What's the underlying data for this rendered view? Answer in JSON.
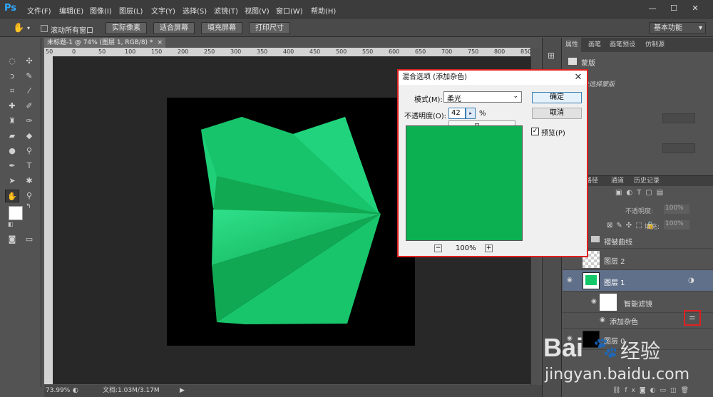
{
  "app": {
    "logo": "Ps"
  },
  "menu": [
    "文件(F)",
    "编辑(E)",
    "图像(I)",
    "图层(L)",
    "文字(Y)",
    "选择(S)",
    "滤镜(T)",
    "视图(V)",
    "窗口(W)",
    "帮助(H)"
  ],
  "window_controls": [
    "—",
    "☐",
    "✕"
  ],
  "options": {
    "scroll_all_label": "滚动所有窗口",
    "btn_actual": "实际像素",
    "btn_fit": "适合屏幕",
    "btn_fill": "填充屏幕",
    "btn_print": "打印尺寸",
    "workspace": "基本功能"
  },
  "document": {
    "tab_title": "未标题-1 @ 74% (图层 1, RGB/8) *",
    "ruler_ticks": [
      "50",
      "0",
      "50",
      "100",
      "150",
      "200",
      "250",
      "300",
      "350",
      "400",
      "450",
      "500",
      "550",
      "600",
      "650",
      "700",
      "750",
      "800",
      "850"
    ],
    "zoom": "73.99%",
    "doc_info": "文档:1.03M/3.17M"
  },
  "properties": {
    "tabs": [
      "属性",
      "画笔",
      "画笔预设",
      "仿制源"
    ],
    "subtitle": "蒙版",
    "note": "未选择蒙版"
  },
  "layers": {
    "tabs": [
      "路径",
      "通道",
      "历史记录"
    ],
    "opacity_label": "不透明度:",
    "opacity_value": "100%",
    "fill_label": "填充:",
    "fill_value": "100%",
    "rows": [
      {
        "name": "褶皱曲线"
      },
      {
        "name": "图层 2"
      },
      {
        "name": "图层 1"
      },
      {
        "name": "智能滤镜"
      },
      {
        "name": "添加杂色"
      },
      {
        "name": "图层 0"
      }
    ]
  },
  "dialog": {
    "title": "混合选项 (添加杂色)",
    "close": "✕",
    "mode_label": "模式(M):",
    "mode_value": "柔光",
    "opacity_label": "不透明度(O):",
    "opacity_value": "42",
    "percent": "%",
    "ok": "确定",
    "cancel": "取消",
    "preview_label": "预览(P)",
    "zoom_out": "−",
    "zoom_in": "+",
    "zoom_level": "100%",
    "preview_color": "#0db050"
  },
  "watermark": {
    "brand": "Bai",
    "paw": "🐾",
    "brand_cn": "经验",
    "url": "jingyan.baidu.com"
  },
  "colors": {
    "accent_red": "#e02020",
    "ps_blue": "#31a8ff",
    "green": "#12c868"
  }
}
